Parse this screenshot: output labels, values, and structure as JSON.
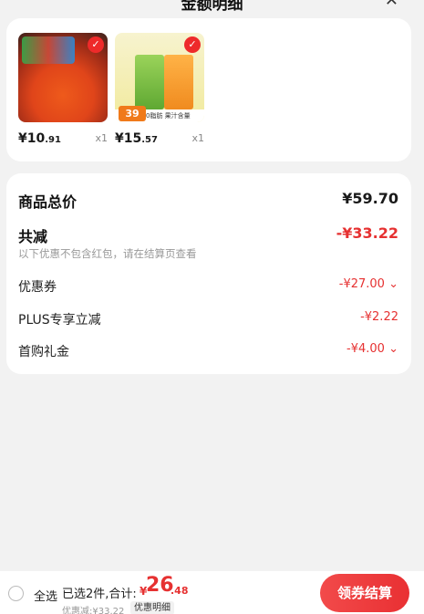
{
  "header": {
    "title": "金额明细",
    "close_icon": "close-icon"
  },
  "products": [
    {
      "price_int": "¥10",
      "price_dec": ".91",
      "qty": "x1",
      "check_icon": "check-icon"
    },
    {
      "price_int": "¥15",
      "price_dec": ".57",
      "qty": "x1",
      "check_icon": "check-icon",
      "img_price_tag": "39",
      "img_tag": "0脂肪  果汁含量100%"
    }
  ],
  "summary": {
    "total_label": "商品总价",
    "total_value": "¥59.70",
    "reduce_label": "共减",
    "reduce_value": "-¥33.22",
    "reduce_note": "以下优惠不包含红包，请在结算页查看",
    "items": [
      {
        "label": "优惠券",
        "value": "-¥27.00",
        "chevron": "⌄"
      },
      {
        "label": "PLUS专享立减",
        "value": "-¥2.22",
        "chevron": ""
      },
      {
        "label": "首购礼金",
        "value": "-¥4.00",
        "chevron": "⌄"
      }
    ]
  },
  "bottom": {
    "select_all": "全选",
    "selected_text": "已选2件,合计:",
    "total_symbol": "¥",
    "total_int": "26",
    "total_dec": ".48",
    "saved_text": "优惠减:¥33.22",
    "detail_label": "优惠明细",
    "checkout_label": "领券结算"
  },
  "colors": {
    "accent": "#e63131",
    "background": "#f2f2f2"
  }
}
